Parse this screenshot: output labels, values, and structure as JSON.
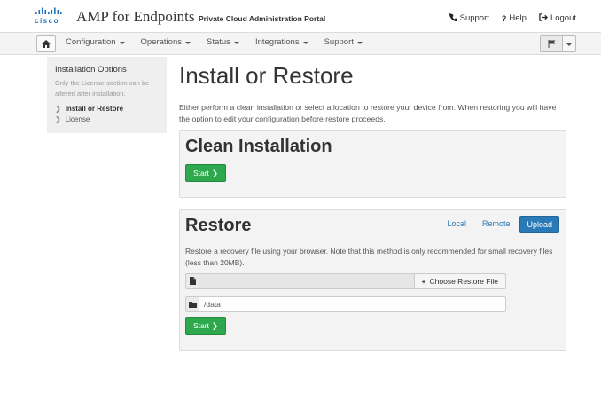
{
  "header": {
    "logo_text": "cisco",
    "app_title": "AMP for Endpoints",
    "portal_name": "Private Cloud Administration Portal",
    "links": [
      {
        "icon": "phone-icon",
        "label": "Support"
      },
      {
        "icon": "question-icon",
        "label": "Help"
      },
      {
        "icon": "logout-icon",
        "label": "Logout"
      }
    ]
  },
  "nav": {
    "home_icon": "home-icon",
    "items": [
      "Configuration",
      "Operations",
      "Status",
      "Integrations",
      "Support"
    ],
    "flag_icon": "flag-icon"
  },
  "sidebar": {
    "heading": "Installation Options",
    "note": "Only the License section can be altered after installation.",
    "items": [
      {
        "label": "Install or Restore",
        "active": true
      },
      {
        "label": "License",
        "active": false
      }
    ]
  },
  "main": {
    "title": "Install or Restore",
    "intro": "Either perform a clean installation or select a location to restore your device from. When restoring you will have the option to edit your configuration before restore proceeds.",
    "clean": {
      "heading": "Clean Installation",
      "start_label": "Start"
    },
    "restore": {
      "heading": "Restore",
      "tabs": [
        {
          "label": "Local",
          "active": false
        },
        {
          "label": "Remote",
          "active": false
        },
        {
          "label": "Upload",
          "active": true
        }
      ],
      "description": "Restore a recovery file using your browser. Note that this method is only recommended for small recovery files (less than 20MB).",
      "choose_label": "Choose Restore File",
      "path_value": "/data",
      "start_label": "Start"
    }
  },
  "colors": {
    "accent_blue": "#2a7ab8",
    "start_green": "#2ea84c",
    "cisco_blue": "#1d6fb8"
  }
}
